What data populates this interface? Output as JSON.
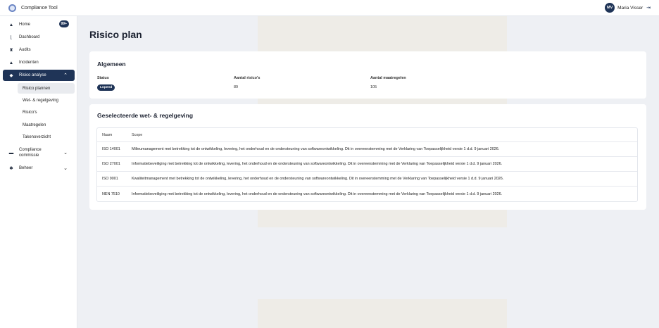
{
  "app": {
    "title": "Compliance Tool"
  },
  "user": {
    "initials": "MV",
    "name": "Maria Visser",
    "logout_icon": "logout-icon"
  },
  "sidebar": {
    "home": {
      "label": "Home",
      "badge": "99+"
    },
    "dashboard": {
      "label": "Dashboard"
    },
    "audits": {
      "label": "Audits"
    },
    "incidenten": {
      "label": "Incidenten"
    },
    "risico_analyse": {
      "label": "Risico analyse"
    },
    "sub": {
      "risico_plannen": "Risico plannen",
      "wet_regelgeving": "Wet- & regelgeving",
      "risicos": "Risico's",
      "maatregelen": "Maatregelen",
      "takenoverzicht": "Takenoverzicht"
    },
    "compliance_commissie": {
      "line1": "Compliance",
      "line2": "commissie"
    },
    "beheer": {
      "label": "Beheer"
    }
  },
  "page": {
    "title": "Risico plan"
  },
  "algemeen": {
    "title": "Algemeen",
    "status_label": "Status",
    "status_value": "Lopend",
    "aantal_risicos_label": "Aantal risico's",
    "aantal_risicos_value": "89",
    "aantal_maatregelen_label": "Aantal maatregelen",
    "aantal_maatregelen_value": "105"
  },
  "regelgeving": {
    "title": "Geselecteerde wet- & regelgeving",
    "headers": {
      "naam": "Naam",
      "scope": "Scope"
    },
    "rows": [
      {
        "naam": "ISO 14001",
        "scope": "Milieumanagement met betrekking tot de ontwikkeling, levering, het onderhoud en de ondersteuning van softwareontwikkeling. Dit in overeenstemming met de Verklaring van Toepasselijkheid versie 1 d.d. 9 januari 2026."
      },
      {
        "naam": "ISO 27001",
        "scope": "Informatiebeveiliging met betrekking tot de ontwikkeling, levering, het onderhoud en de ondersteuning van softwareontwikkeling. Dit in overeenstemming met de Verklaring van Toepasselijkheid versie 1 d.d. 9 januari 2026."
      },
      {
        "naam": "ISO 9001",
        "scope": "Kwaliteitmanagement met betrekking tot de ontwikkeling, levering, het onderhoud en de ondersteuning van softwareontwikkeling. Dit in overeenstemming met de Verklaring van Toepasselijkheid versie 1 d.d. 9 januari 2026."
      },
      {
        "naam": "NEN 7510",
        "scope": "Informatiebeveiliging met betrekking tot de ontwikkeling, levering, het onderhoud en de ondersteuning van softwareontwikkeling. Dit in overeenstemming met de Verklaring van Toepasselijkheid versie 1 d.d. 9 januari 2026."
      }
    ]
  },
  "colors": {
    "primary": "#1f3457",
    "background": "#eef0f4",
    "card": "#ffffff"
  }
}
